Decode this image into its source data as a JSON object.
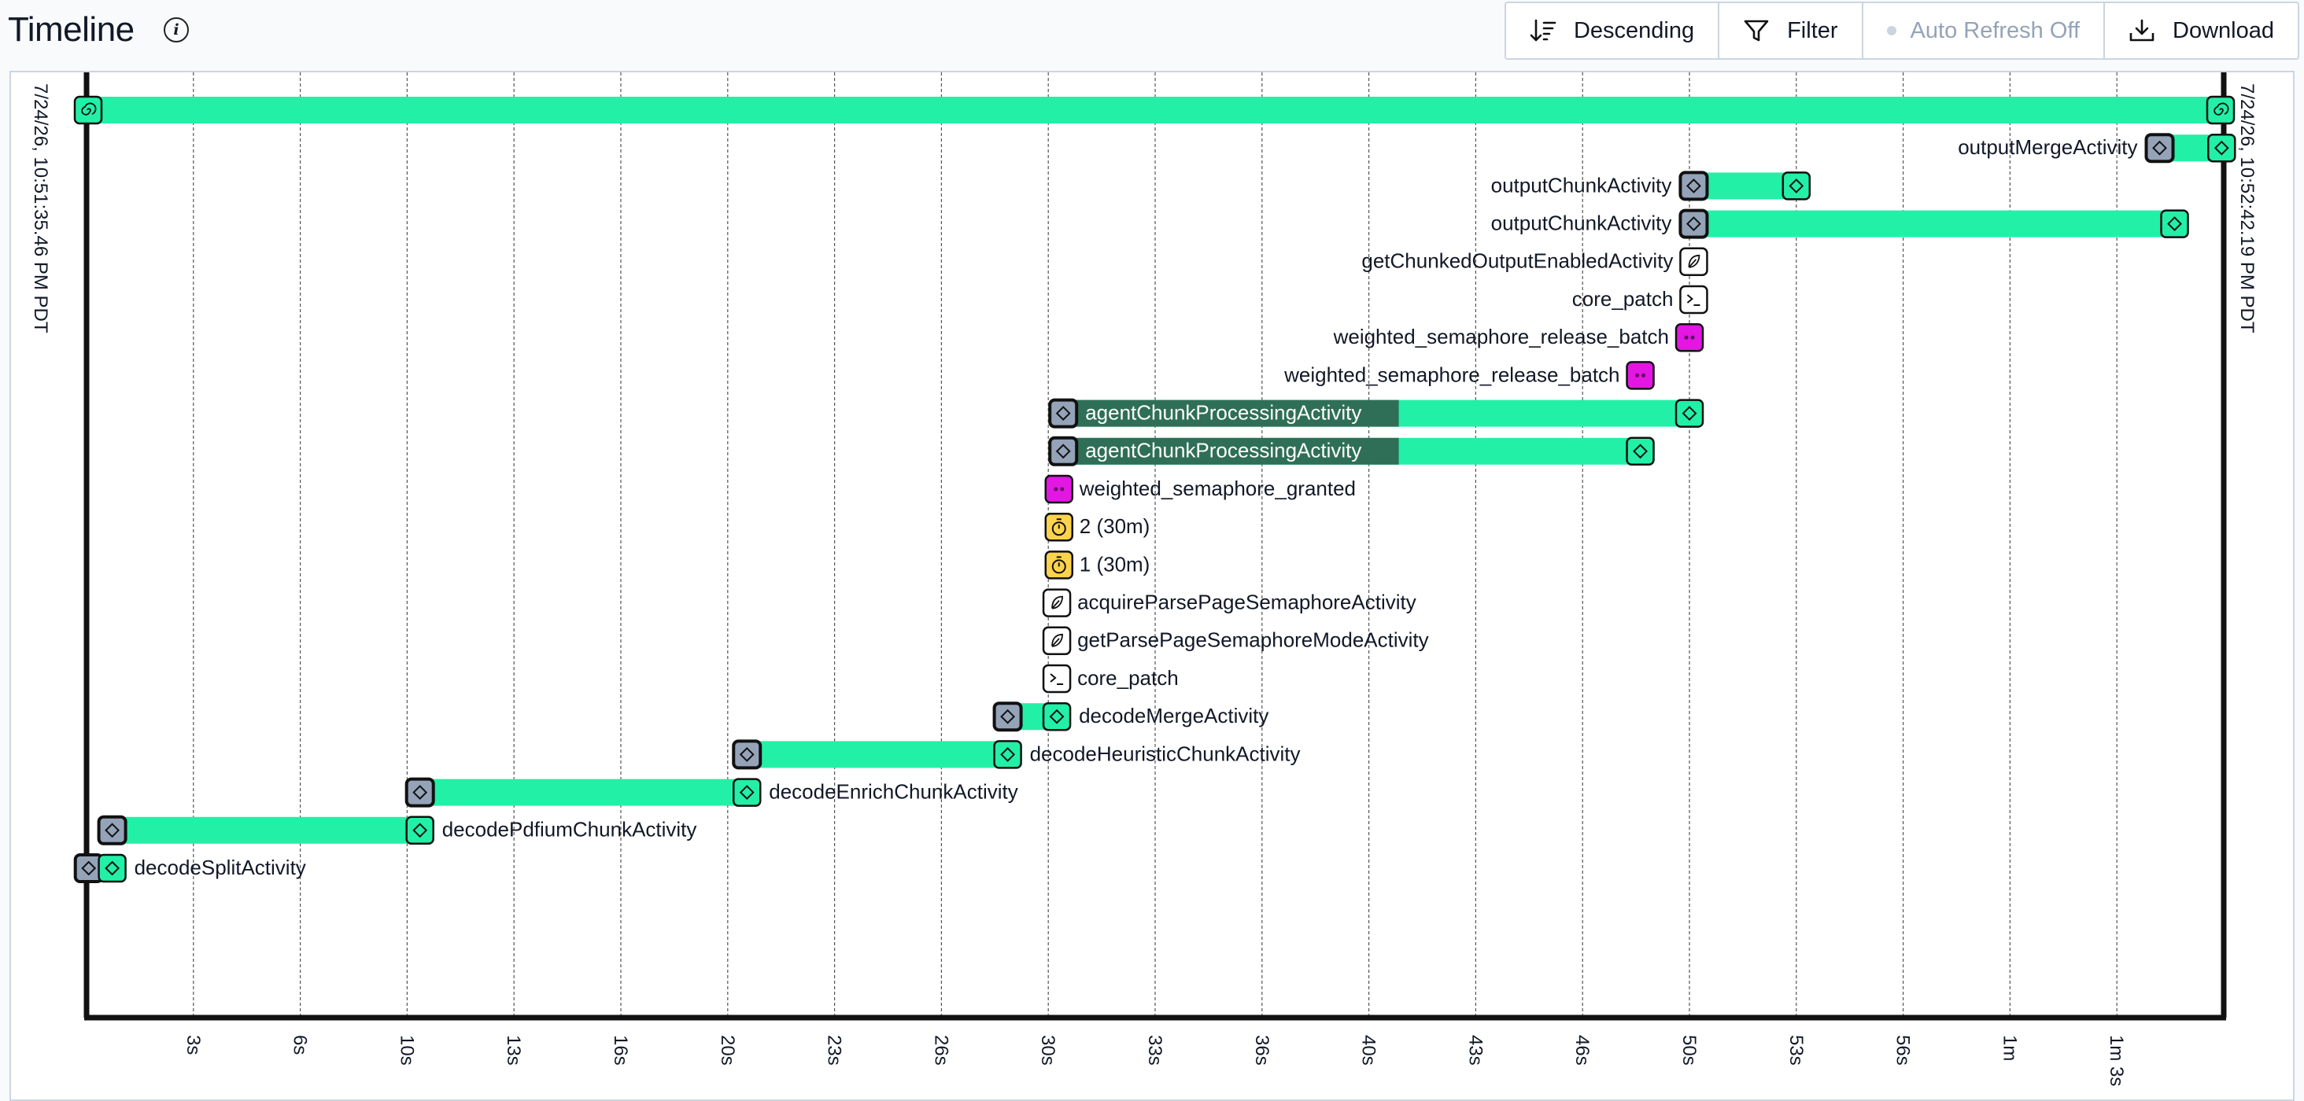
{
  "header": {
    "title": "Timeline",
    "info_icon": "info-icon",
    "buttons": {
      "sort": "Descending",
      "filter": "Filter",
      "auto_refresh": "Auto Refresh Off",
      "download": "Download"
    }
  },
  "timeline": {
    "start_label": "7/24/26, 10:51:35.46 PM PDT",
    "end_label": "7/24/26, 10:52:42.19 PM PDT",
    "ticks": [
      "3s",
      "6s",
      "10s",
      "13s",
      "16s",
      "20s",
      "23s",
      "26s",
      "30s",
      "33s",
      "36s",
      "40s",
      "43s",
      "46s",
      "50s",
      "53s",
      "56s",
      "1m",
      "1m 3s"
    ],
    "colors": {
      "bar": "#22f0a6",
      "bar_dark": "#2f6f57",
      "pending": "#94a3b8",
      "signal": "#e316e3",
      "timer": "#fcd34d",
      "axis": "#111111"
    },
    "rows": [
      {
        "label": "",
        "kind": "workflow",
        "start": 0,
        "end": 100
      },
      {
        "label": "outputMergeActivity",
        "kind": "activity",
        "start": 97.0,
        "end": 99.9
      },
      {
        "label": "outputChunkActivity",
        "kind": "activity",
        "start": 75.2,
        "end": 80.0
      },
      {
        "label": "outputChunkActivity",
        "kind": "activity",
        "start": 75.2,
        "end": 97.7
      },
      {
        "label": "getChunkedOutputEnabledActivity",
        "kind": "local",
        "start": 75.2
      },
      {
        "label": "core_patch",
        "kind": "marker",
        "start": 75.2
      },
      {
        "label": "weighted_semaphore_release_batch",
        "kind": "signal",
        "start": 75.0
      },
      {
        "label": "weighted_semaphore_release_batch",
        "kind": "signal",
        "start": 72.7
      },
      {
        "label": "agentChunkProcessingActivity",
        "kind": "activity_running",
        "start": 45.7,
        "dark_end": 61.4,
        "end": 75.0
      },
      {
        "label": "agentChunkProcessingActivity",
        "kind": "activity_running",
        "start": 45.7,
        "dark_end": 61.4,
        "end": 72.7
      },
      {
        "label": "weighted_semaphore_granted",
        "kind": "signal",
        "start": 45.5
      },
      {
        "label": "2 (30m)",
        "kind": "timer",
        "start": 45.5
      },
      {
        "label": "1 (30m)",
        "kind": "timer",
        "start": 45.5
      },
      {
        "label": "acquireParsePageSemaphoreActivity",
        "kind": "local",
        "start": 45.4
      },
      {
        "label": "getParsePageSemaphoreModeActivity",
        "kind": "local",
        "start": 45.4
      },
      {
        "label": "core_patch",
        "kind": "marker",
        "start": 45.4
      },
      {
        "label": "decodeMergeActivity",
        "kind": "activity",
        "start": 43.1,
        "end": 45.4
      },
      {
        "label": "decodeHeuristicChunkActivity",
        "kind": "activity",
        "start": 30.9,
        "end": 43.1
      },
      {
        "label": "decodeEnrichChunkActivity",
        "kind": "activity",
        "start": 15.6,
        "end": 30.9
      },
      {
        "label": "decodePdfiumChunkActivity",
        "kind": "activity",
        "start": 1.2,
        "end": 15.6
      },
      {
        "label": "decodeSplitActivity",
        "kind": "activity",
        "start": 0.1,
        "end": 1.2
      }
    ]
  }
}
